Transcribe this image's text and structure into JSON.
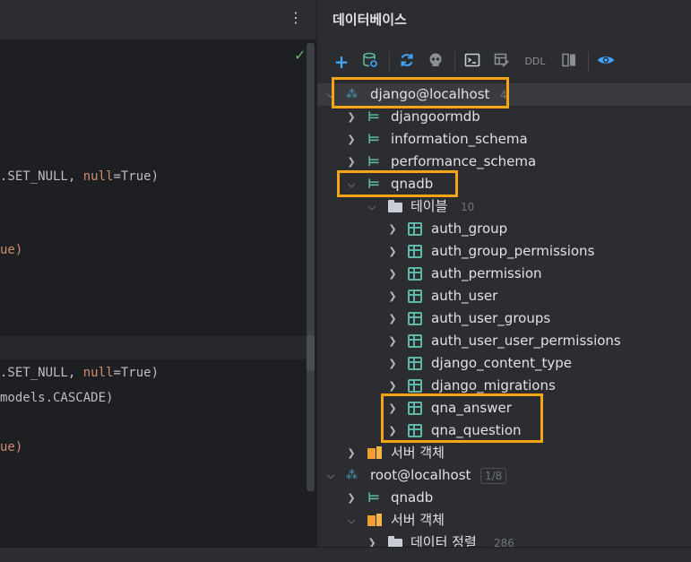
{
  "editor": {
    "kebab_glyph": "⋮",
    "check_glyph": "✓",
    "lines": {
      "l1": {
        "pre": ".SET_NULL, ",
        "kw": "null",
        "post": "=True)"
      },
      "l2": {
        "pre": "ue)"
      },
      "l3": {
        "pre": ".SET_NULL, ",
        "kw": "null",
        "post": "=True)"
      },
      "l4": {
        "pre": "models.CASCADE)"
      },
      "l5": {
        "pre": "ue)"
      }
    }
  },
  "db_panel": {
    "title": "데이터베이스",
    "toolbar": {
      "add": "+",
      "ddl": "DDL"
    },
    "tree": {
      "conn1": {
        "label": "django@localhost",
        "count": "4"
      },
      "djangoormdb": {
        "label": "djangoormdb"
      },
      "information_schema": {
        "label": "information_schema"
      },
      "performance_schema": {
        "label": "performance_schema"
      },
      "qnadb": {
        "label": "qnadb"
      },
      "tables_folder": {
        "label": "테이블",
        "count": "10"
      },
      "tables": [
        "auth_group",
        "auth_group_permissions",
        "auth_permission",
        "auth_user",
        "auth_user_groups",
        "auth_user_user_permissions",
        "django_content_type",
        "django_migrations",
        "qna_answer",
        "qna_question"
      ],
      "server_objects": {
        "label": "서버 객체"
      },
      "conn2": {
        "label": "root@localhost",
        "count": "1/8"
      },
      "qnadb2": {
        "label": "qnadb"
      },
      "server_objects2": {
        "label": "서버 객체"
      },
      "collation": {
        "label": "데이터 정렬",
        "count": "286"
      }
    }
  },
  "colors": {
    "highlight_border": "#f5a516",
    "schema_icon": "#5cb89a",
    "table_icon": "#5fb8a8"
  }
}
